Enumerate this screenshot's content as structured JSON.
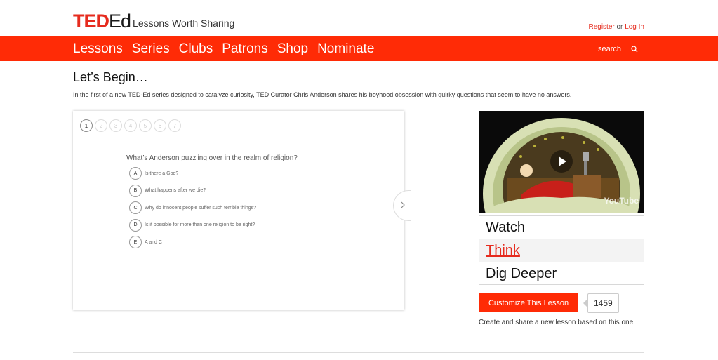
{
  "header": {
    "logo_ted": "TED",
    "logo_ed": "Ed",
    "tagline": "Lessons Worth Sharing",
    "register": "Register",
    "or": "or",
    "login": "Log In"
  },
  "nav": {
    "items": [
      {
        "label": "Lessons"
      },
      {
        "label": "Series"
      },
      {
        "label": "Clubs"
      },
      {
        "label": "Patrons"
      },
      {
        "label": "Shop"
      },
      {
        "label": "Nominate"
      }
    ],
    "search_label": "search",
    "search_icon": "search-icon"
  },
  "main": {
    "heading": "Let’s Begin…",
    "intro": "In the first of a new TED-Ed series designed to catalyze curiosity, TED Curator Chris Anderson shares his boyhood obsession with quirky questions that seem to have no answers."
  },
  "quiz": {
    "steps": [
      "1",
      "2",
      "3",
      "4",
      "5",
      "6",
      "7"
    ],
    "active_step": "1",
    "question": "What’s Anderson puzzling over in the realm of religion?",
    "options": [
      {
        "letter": "A",
        "text": "Is there a God?"
      },
      {
        "letter": "B",
        "text": "What happens after we die?"
      },
      {
        "letter": "C",
        "text": "Why do innocent people suffer such terrible things?"
      },
      {
        "letter": "D",
        "text": "Is it possible for more than one religion to be right?"
      },
      {
        "letter": "E",
        "text": "A and C"
      }
    ],
    "next_icon": "chevron-right-icon"
  },
  "sidebar": {
    "video_badge": "YouTube",
    "links": [
      {
        "label": "Watch"
      },
      {
        "label": "Think",
        "active": true
      },
      {
        "label": "Dig Deeper"
      }
    ],
    "customize_label": "Customize This Lesson",
    "count": "1459",
    "create_text": "Create and share a new lesson based on this one."
  },
  "colors": {
    "brand_red": "#ff2b06",
    "link_red": "#e62b1e"
  }
}
